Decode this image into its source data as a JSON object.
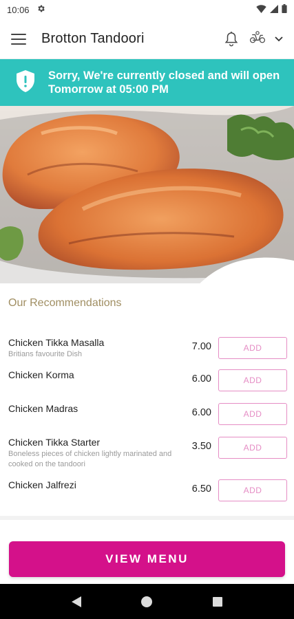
{
  "status_bar": {
    "time": "10:06"
  },
  "app_bar": {
    "title": "Brotton Tandoori"
  },
  "banner": {
    "message": "Sorry, We're currently closed and will open Tomorrow at 05:00 PM",
    "color": "#2ec3bd"
  },
  "recommendations": {
    "title": "Our Recommendations",
    "items": [
      {
        "name": "Chicken Tikka Masalla",
        "description": "Britians favourite Dish",
        "price": "7.00",
        "add_label": "ADD"
      },
      {
        "name": "Chicken Korma",
        "description": "",
        "price": "6.00",
        "add_label": "ADD"
      },
      {
        "name": "Chicken Madras",
        "description": "",
        "price": "6.00",
        "add_label": "ADD"
      },
      {
        "name": "Chicken Tikka Starter",
        "description": "Boneless pieces of chicken lightly marinated and cooked on the tandoori",
        "price": "3.50",
        "add_label": "ADD"
      },
      {
        "name": "Chicken Jalfrezi",
        "description": "",
        "price": "6.50",
        "add_label": "ADD"
      }
    ]
  },
  "view_menu": {
    "label": "VIEW MENU",
    "color": "#d4118a"
  },
  "colors": {
    "accent_pink": "#e58cc4",
    "section_title": "#a08e62"
  }
}
